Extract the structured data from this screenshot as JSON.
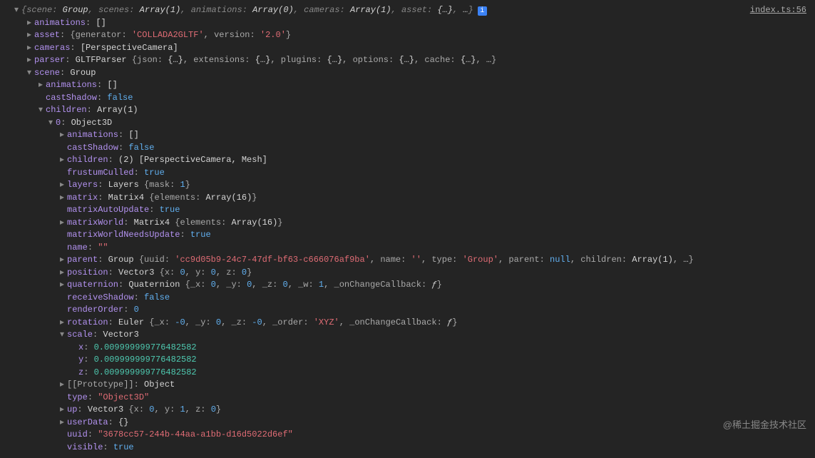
{
  "sourceLink": "index.ts:56",
  "watermark": "@稀土掘金技术社区",
  "infoBadge": "i",
  "topLine": {
    "scene": "scene",
    "sceneVal": "Group",
    "scenes": "scenes",
    "scenesVal": "Array(1)",
    "animations": "animations",
    "animationsVal": "Array(0)",
    "cameras": "cameras",
    "camerasVal": "Array(1)",
    "asset": "asset",
    "assetVal": "{…}",
    "ellipsis": "…"
  },
  "r1": {
    "key": "animations",
    "val": "[]"
  },
  "r2": {
    "key": "asset",
    "gen": "generator",
    "genVal": "'COLLADA2GLTF'",
    "ver": "version",
    "verVal": "'2.0'"
  },
  "r3": {
    "key": "cameras",
    "val": "[PerspectiveCamera]"
  },
  "r4": {
    "key": "parser",
    "cls": "GLTFParser",
    "json": "json",
    "jsonV": "{…}",
    "ext": "extensions",
    "extV": "{…}",
    "plg": "plugins",
    "plgV": "{…}",
    "opt": "options",
    "optV": "{…}",
    "cache": "cache",
    "cacheV": "{…}",
    "ell": "…"
  },
  "r5": {
    "key": "scene",
    "val": "Group"
  },
  "r6": {
    "key": "animations",
    "val": "[]"
  },
  "r7": {
    "key": "castShadow",
    "val": "false"
  },
  "r8": {
    "key": "children",
    "val": "Array(1)"
  },
  "r9": {
    "key": "0",
    "val": "Object3D"
  },
  "r10": {
    "key": "animations",
    "val": "[]"
  },
  "r11": {
    "key": "castShadow",
    "val": "false"
  },
  "r12": {
    "key": "children",
    "count": "(2)",
    "val": "[PerspectiveCamera, Mesh]"
  },
  "r13": {
    "key": "frustumCulled",
    "val": "true"
  },
  "r14": {
    "key": "layers",
    "cls": "Layers",
    "mask": "mask",
    "maskV": "1"
  },
  "r15": {
    "key": "matrix",
    "cls": "Matrix4",
    "el": "elements",
    "elV": "Array(16)"
  },
  "r16": {
    "key": "matrixAutoUpdate",
    "val": "true"
  },
  "r17": {
    "key": "matrixWorld",
    "cls": "Matrix4",
    "el": "elements",
    "elV": "Array(16)"
  },
  "r18": {
    "key": "matrixWorldNeedsUpdate",
    "val": "true"
  },
  "r19": {
    "key": "name",
    "val": "\"\""
  },
  "r20": {
    "key": "parent",
    "cls": "Group",
    "uuid": "uuid",
    "uuidV": "'cc9d05b9-24c7-47df-bf63-c666076af9ba'",
    "name": "name",
    "nameV": "''",
    "type": "type",
    "typeV": "'Group'",
    "par": "parent",
    "parV": "null",
    "ch": "children",
    "chV": "Array(1)",
    "ell": "…"
  },
  "r21": {
    "key": "position",
    "cls": "Vector3",
    "x": "x",
    "xV": "0",
    "y": "y",
    "yV": "0",
    "z": "z",
    "zV": "0"
  },
  "r22": {
    "key": "quaternion",
    "cls": "Quaternion",
    "x": "_x",
    "xV": "0",
    "y": "_y",
    "yV": "0",
    "z": "_z",
    "zV": "0",
    "w": "_w",
    "wV": "1",
    "cb": "_onChangeCallback",
    "cbV": "ƒ"
  },
  "r23": {
    "key": "receiveShadow",
    "val": "false"
  },
  "r24": {
    "key": "renderOrder",
    "val": "0"
  },
  "r25": {
    "key": "rotation",
    "cls": "Euler",
    "x": "_x",
    "xV": "-0",
    "y": "_y",
    "yV": "0",
    "z": "_z",
    "zV": "-0",
    "o": "_order",
    "oV": "'XYZ'",
    "cb": "_onChangeCallback",
    "cbV": "ƒ"
  },
  "r26": {
    "key": "scale",
    "val": "Vector3"
  },
  "r27": {
    "key": "x",
    "val": "0.009999999776482582"
  },
  "r28": {
    "key": "y",
    "val": "0.009999999776482582"
  },
  "r29": {
    "key": "z",
    "val": "0.009999999776482582"
  },
  "r30": {
    "key": "[[Prototype]]",
    "val": "Object"
  },
  "r31": {
    "key": "type",
    "val": "\"Object3D\""
  },
  "r32": {
    "key": "up",
    "cls": "Vector3",
    "x": "x",
    "xV": "0",
    "y": "y",
    "yV": "1",
    "z": "z",
    "zV": "0"
  },
  "r33": {
    "key": "userData",
    "val": "{}"
  },
  "r34": {
    "key": "uuid",
    "val": "\"3678cc57-244b-44aa-a1bb-d16d5022d6ef\""
  },
  "r35": {
    "key": "visible",
    "val": "true"
  }
}
